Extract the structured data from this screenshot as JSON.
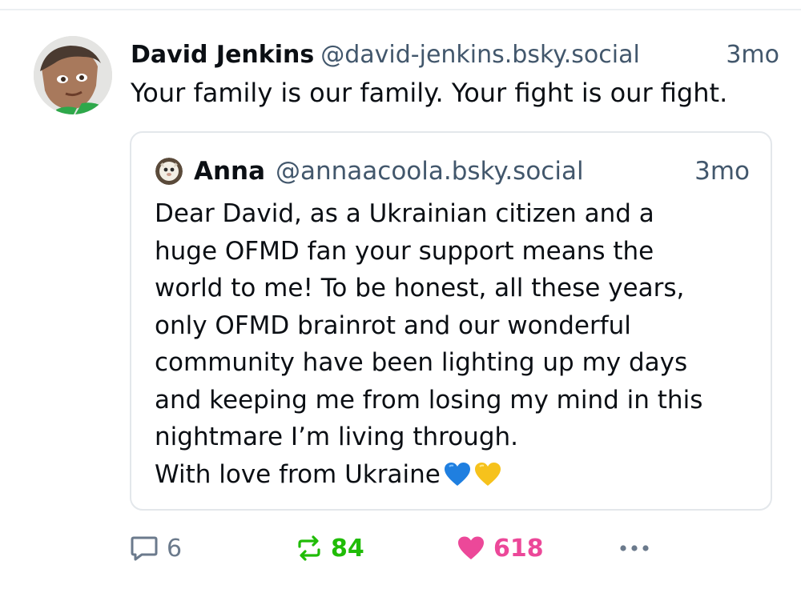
{
  "post": {
    "author": {
      "name": "David Jenkins",
      "handle": "@david-jenkins.bsky.social"
    },
    "time": "3mo",
    "text": "Your family is our family. Your fight is our fight."
  },
  "quote": {
    "author": {
      "name": "Anna",
      "handle": "@annaacoola.bsky.social"
    },
    "time": "3mo",
    "text": "Dear David, as a Ukrainian citizen and a\nhuge OFMD fan your support means the\nworld to me! To be honest, all these years,\nonly OFMD brainrot and our wonderful\ncommunity have been lighting up my days\nand keeping me from losing my mind in this\nnightmare I’m living through.\nWith love from Ukraine",
    "emojis": [
      "blue-heart-emoji",
      "yellow-heart-emoji"
    ]
  },
  "actions": {
    "reply_count": "6",
    "repost_count": "84",
    "like_count": "618"
  },
  "colors": {
    "repost_active": "#20bc07",
    "like_active": "#ec4899",
    "secondary_text": "#42576c",
    "border": "#e3e7eb"
  },
  "icons": {
    "reply": "reply-icon",
    "repost": "repost-icon",
    "like": "heart-icon",
    "more": "more-options-icon"
  }
}
